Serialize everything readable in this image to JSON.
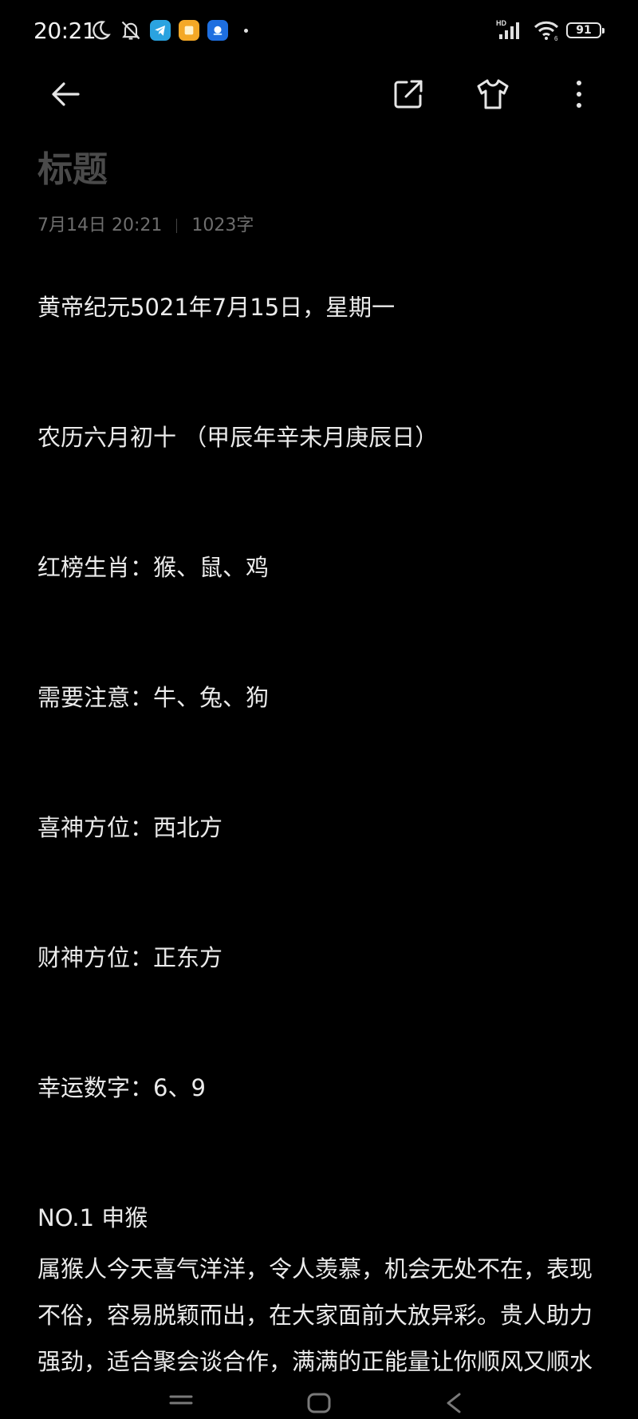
{
  "status_bar": {
    "time": "20:21",
    "battery_level": "91",
    "network": "HD"
  },
  "note": {
    "title": "标题",
    "date": "7月14日 20:21",
    "word_count": "1023字"
  },
  "content": {
    "lines": [
      "黄帝纪元5021年7月15日，星期一",
      "农历六月初十 （甲辰年辛未月庚辰日）",
      "红榜生肖：猴、鼠、鸡",
      "需要注意：牛、兔、狗",
      "喜神方位：西北方",
      "财神方位：正东方",
      "幸运数字：6、9"
    ],
    "section_heading": "NO.1  申猴",
    "paragraph": "属猴人今天喜气洋洋，令人羡慕，机会无处不在，表现不俗，容易脱颖而出，在大家面前大放异彩。贵人助力强劲，适合聚会谈合作，满满的正能量让你顺风又顺水"
  },
  "icons": {
    "back": "arrow-left-icon",
    "share": "share-icon",
    "theme": "shirt-icon",
    "more": "more-vertical-icon"
  }
}
